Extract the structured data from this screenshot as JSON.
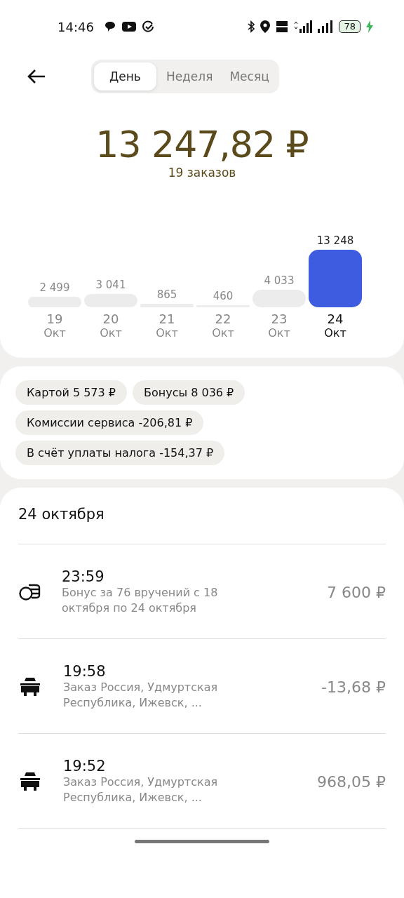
{
  "status_bar": {
    "time": "14:46",
    "battery": "78"
  },
  "tabs": [
    {
      "label": "День",
      "selected": true
    },
    {
      "label": "Неделя",
      "selected": false
    },
    {
      "label": "Месяц",
      "selected": false
    }
  ],
  "summary": {
    "total": "13 247,82 ₽",
    "orders": "19 заказов"
  },
  "chart": {
    "chart_data": {
      "type": "bar",
      "categories": [
        "19",
        "20",
        "21",
        "22",
        "23",
        "24"
      ],
      "values": [
        2499,
        3041,
        865,
        460,
        4033,
        13248
      ],
      "data_labels": true
    },
    "days": [
      {
        "value": "2 499",
        "month": "Окт",
        "selected": false
      },
      {
        "value": "3 041",
        "month": "Окт",
        "selected": false
      },
      {
        "value": "865",
        "month": "Окт",
        "selected": false
      },
      {
        "value": "460",
        "month": "Окт",
        "selected": false
      },
      {
        "value": "4 033",
        "month": "Окт",
        "selected": false
      },
      {
        "value": "13 248",
        "month": "Окт",
        "selected": true
      }
    ]
  },
  "breakdown": [
    "Картой 5 573 ₽",
    "Бонусы 8 036 ₽",
    "Комиссии сервиса -206,81 ₽",
    "В счёт уплаты налога -154,37 ₽"
  ],
  "operations": {
    "date": "24 октября",
    "items": [
      {
        "kind": "bonus",
        "time": "23:59",
        "description": "Бонус за 76 вручений с 18 октября по 24 октября",
        "amount": "7 600 ₽"
      },
      {
        "kind": "order",
        "time": "19:58",
        "description": "Заказ Россия, Удмуртская Республика, Ижевск, ...",
        "amount": "-13,68 ₽"
      },
      {
        "kind": "order",
        "time": "19:52",
        "description": "Заказ Россия, Удмуртская Республика, Ижевск, ...",
        "amount": "968,05 ₽"
      }
    ]
  }
}
